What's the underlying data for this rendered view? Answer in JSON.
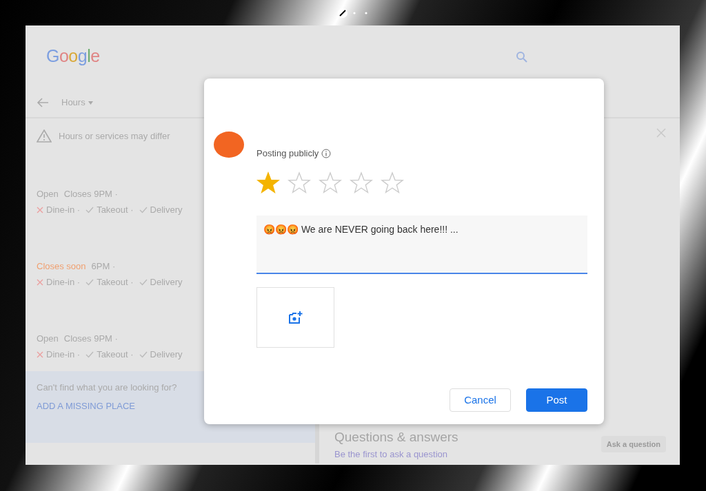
{
  "background_page": {
    "logo": "Google",
    "nav_label": "Hours",
    "notice": "Hours or services may differ",
    "places": [
      {
        "status": "Open",
        "color": "#aaaaaa",
        "hours": "Closes 9PM ·",
        "services": [
          {
            "label": "Dine-in ·",
            "available": false
          },
          {
            "label": "Takeout ·",
            "available": true
          },
          {
            "label": "Delivery",
            "available": true
          }
        ]
      },
      {
        "status": "Closes soon",
        "color": "#f0a070",
        "hours": "6PM ·",
        "services": [
          {
            "label": "Dine-in ·",
            "available": false
          },
          {
            "label": "Takeout ·",
            "available": true
          },
          {
            "label": "Delivery",
            "available": true
          }
        ]
      },
      {
        "status": "Open",
        "color": "#aaaaaa",
        "hours": "Closes 9PM ·",
        "services": [
          {
            "label": "Dine-in ·",
            "available": false
          },
          {
            "label": "Takeout ·",
            "available": true
          },
          {
            "label": "Delivery",
            "available": true
          }
        ]
      }
    ],
    "missing_prompt": "Can't find what you are looking for?",
    "missing_link": "ADD A MISSING PLACE",
    "qa": {
      "title": "Questions & answers",
      "subtitle": "Be the first to ask a question",
      "button": "Ask a question"
    }
  },
  "dialog": {
    "posting_label": "Posting publicly",
    "stars": 1,
    "review_text": "😡😡😡 We are NEVER going back here!!! ...",
    "buttons": [
      {
        "label": "Cancel",
        "kind": "secondary"
      },
      {
        "label": "Post",
        "kind": "primary"
      }
    ]
  }
}
